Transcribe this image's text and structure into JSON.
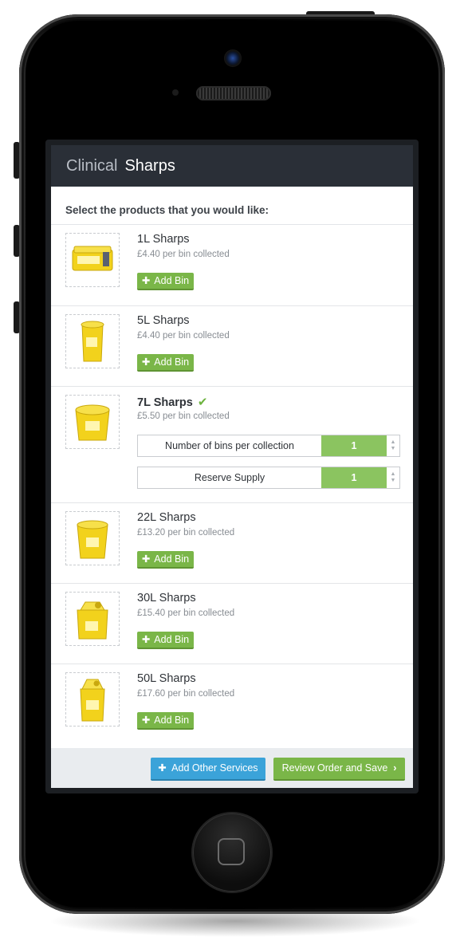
{
  "header": {
    "category": "Clinical",
    "title": "Sharps"
  },
  "intro": "Select the products that you would like:",
  "products": [
    {
      "name": "1L Sharps",
      "price": "£4.40 per bin collected",
      "add_label": "Add Bin",
      "image": "sharps-bin-1l-icon"
    },
    {
      "name": "5L Sharps",
      "price": "£4.40 per bin collected",
      "add_label": "Add Bin",
      "image": "sharps-bin-5l-icon"
    },
    {
      "name": "7L Sharps",
      "price": "£5.50 per bin collected",
      "selected": true,
      "image": "sharps-bin-7l-icon",
      "steppers": [
        {
          "label": "Number of bins per collection",
          "value": "1"
        },
        {
          "label": "Reserve Supply",
          "value": "1"
        }
      ]
    },
    {
      "name": "22L Sharps",
      "price": "£13.20 per bin collected",
      "add_label": "Add Bin",
      "image": "sharps-bin-22l-icon"
    },
    {
      "name": "30L Sharps",
      "price": "£15.40 per bin collected",
      "add_label": "Add Bin",
      "image": "sharps-bin-30l-icon"
    },
    {
      "name": "50L Sharps",
      "price": "£17.60 per bin collected",
      "add_label": "Add Bin",
      "image": "sharps-bin-50l-icon"
    }
  ],
  "footer": {
    "other_label": "Add Other Services",
    "review_label": "Review Order and Save"
  },
  "colors": {
    "header_bg": "#2a2f37",
    "accent_green": "#7ab648",
    "accent_blue": "#3ba3d9",
    "bin_yellow": "#f2d21c"
  }
}
